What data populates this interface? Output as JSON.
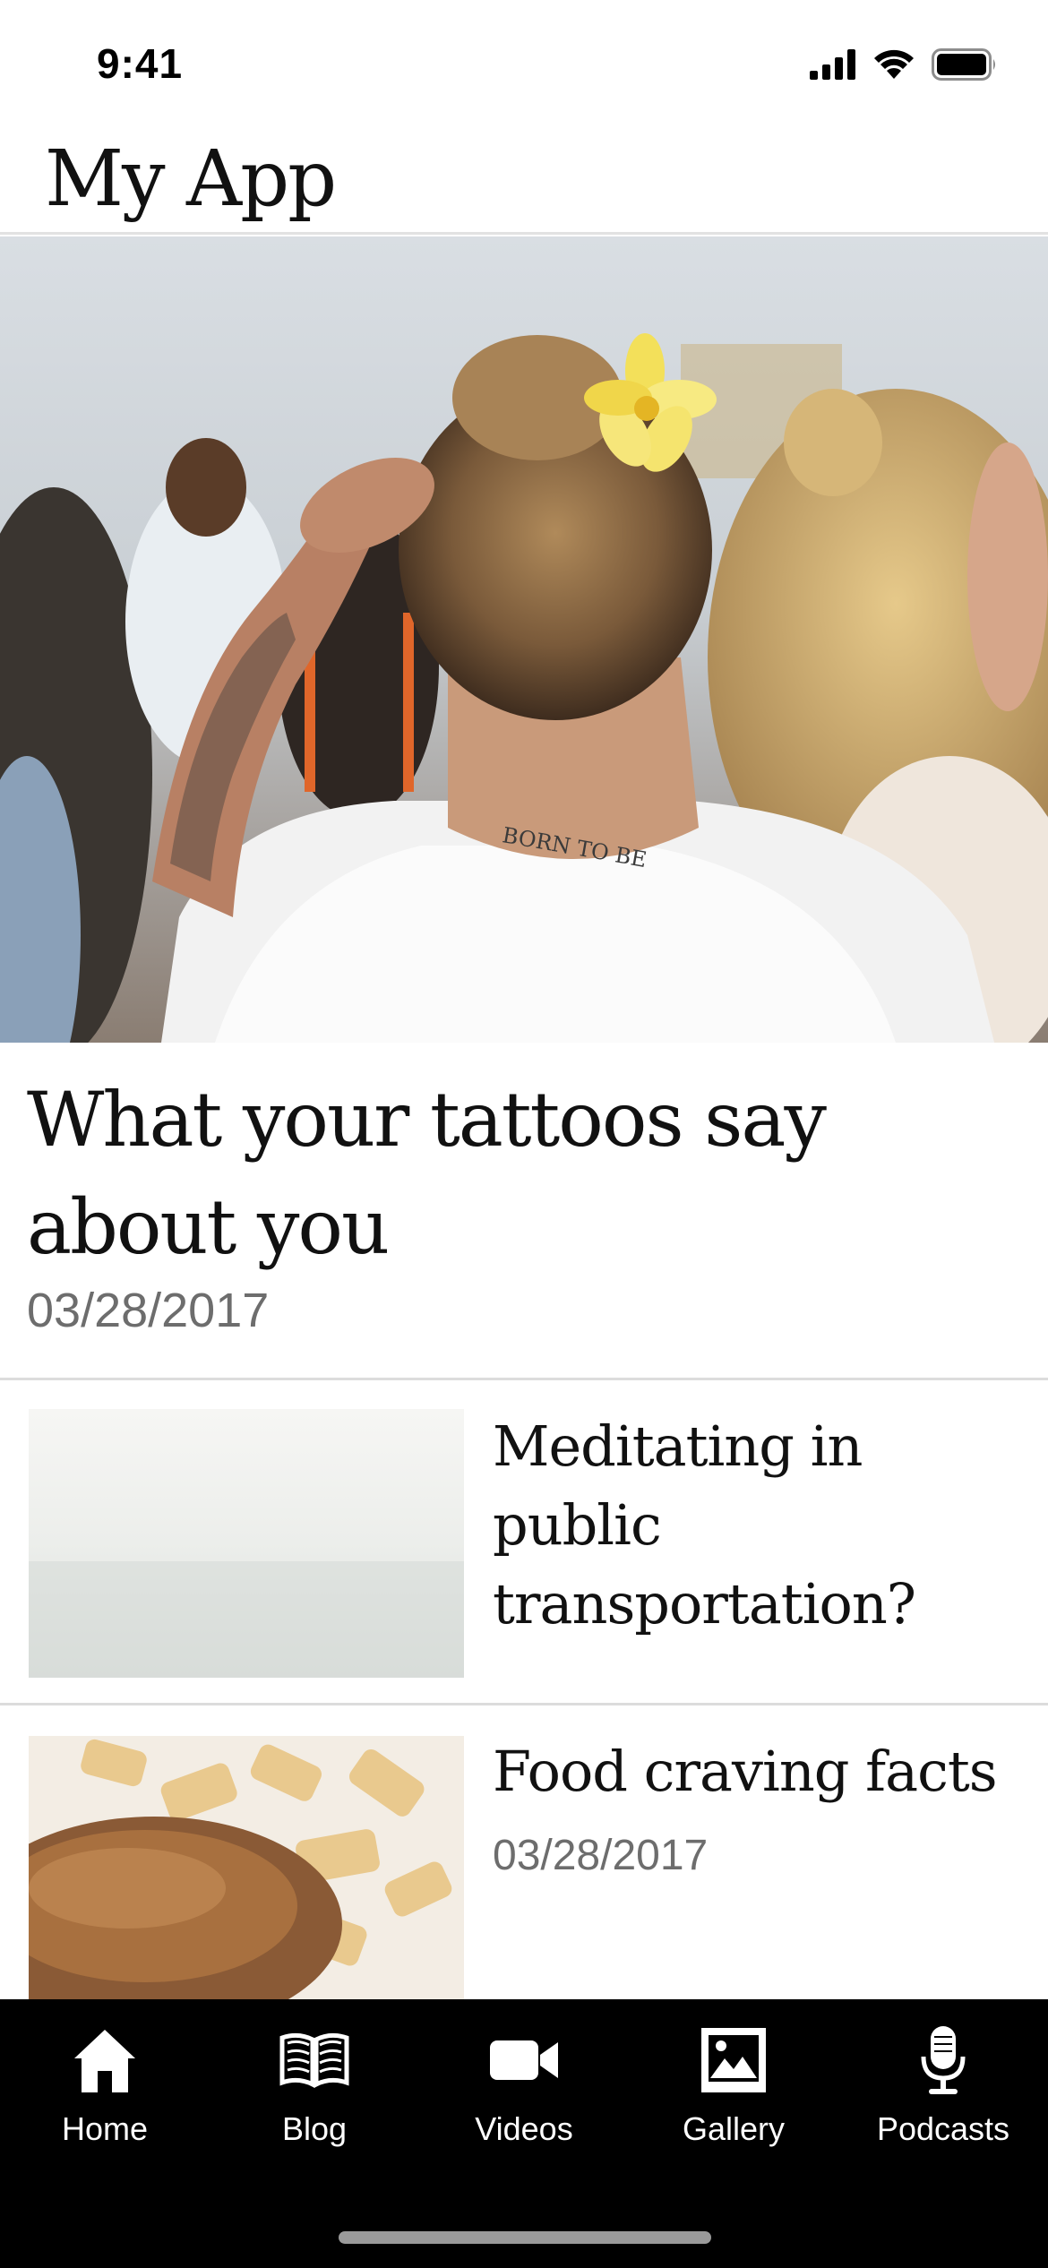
{
  "status_bar": {
    "time": "9:41"
  },
  "header": {
    "title": "My App"
  },
  "hero": {
    "title": "What your tattoos say about you",
    "date": "03/28/2017"
  },
  "articles": [
    {
      "title": "Meditating in public transportation?",
      "date": ""
    },
    {
      "title": "Food craving facts",
      "date": "03/28/2017"
    }
  ],
  "tabs": [
    {
      "label": "Home",
      "icon": "home-icon"
    },
    {
      "label": "Blog",
      "icon": "book-icon"
    },
    {
      "label": "Videos",
      "icon": "video-camera-icon"
    },
    {
      "label": "Gallery",
      "icon": "image-icon"
    },
    {
      "label": "Podcasts",
      "icon": "microphone-icon"
    }
  ],
  "colors": {
    "tab_bar_bg": "#000000",
    "date_text": "#6d6d6d",
    "title_text": "#111111"
  }
}
